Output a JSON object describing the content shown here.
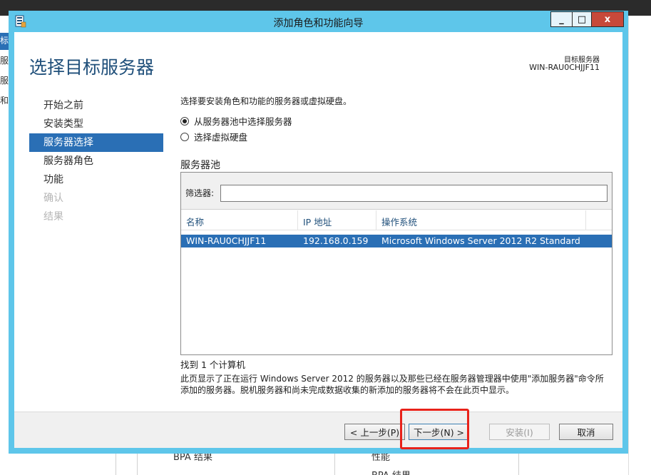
{
  "window": {
    "title": "添加角色和功能向导",
    "minimize": "_",
    "maximize": "□",
    "close": "x"
  },
  "header": {
    "page_title": "选择目标服务器",
    "dest_label": "目标服务器",
    "dest_value": "WIN-RAU0CHJJF11"
  },
  "nav": {
    "items": [
      {
        "label": "开始之前",
        "state": "normal"
      },
      {
        "label": "安装类型",
        "state": "normal"
      },
      {
        "label": "服务器选择",
        "state": "active"
      },
      {
        "label": "服务器角色",
        "state": "normal"
      },
      {
        "label": "功能",
        "state": "normal"
      },
      {
        "label": "确认",
        "state": "disabled"
      },
      {
        "label": "结果",
        "state": "disabled"
      }
    ]
  },
  "content": {
    "intro": "选择要安装角色和功能的服务器或虚拟硬盘。",
    "radio_pool": "从服务器池中选择服务器",
    "radio_vhd": "选择虚拟硬盘",
    "selected_option": "pool",
    "pool_label": "服务器池",
    "filter_label": "筛选器:",
    "filter_value": "",
    "columns": [
      "名称",
      "IP 地址",
      "操作系统"
    ],
    "rows": [
      {
        "name": "WIN-RAU0CHJJF11",
        "ip": "192.168.0.159",
        "os": "Microsoft Windows Server 2012 R2 Standard"
      }
    ],
    "found": "找到 1 个计算机",
    "description": "此页显示了正在运行 Windows Server 2012 的服务器以及那些已经在服务器管理器中使用\"添加服务器\"命令所添加的服务器。脱机服务器和尚未完成数据收集的新添加的服务器将不会在此页中显示。"
  },
  "footer": {
    "prev": "< 上一步(P)",
    "next": "下一步(N) >",
    "install": "安装(I)",
    "cancel": "取消"
  },
  "background": {
    "left_nav_items": [
      "标",
      "服",
      "服",
      "和"
    ],
    "bottom_text_1": "BPA 结果",
    "bottom_text_2": "性能",
    "bottom_text_3": "BPA 结果"
  },
  "colors": {
    "window_frame": "#5ec6ea",
    "selection": "#2a6fb5",
    "title_text": "#1f4f7a",
    "close_button": "#c7493a",
    "highlight_box": "#e8221a"
  }
}
